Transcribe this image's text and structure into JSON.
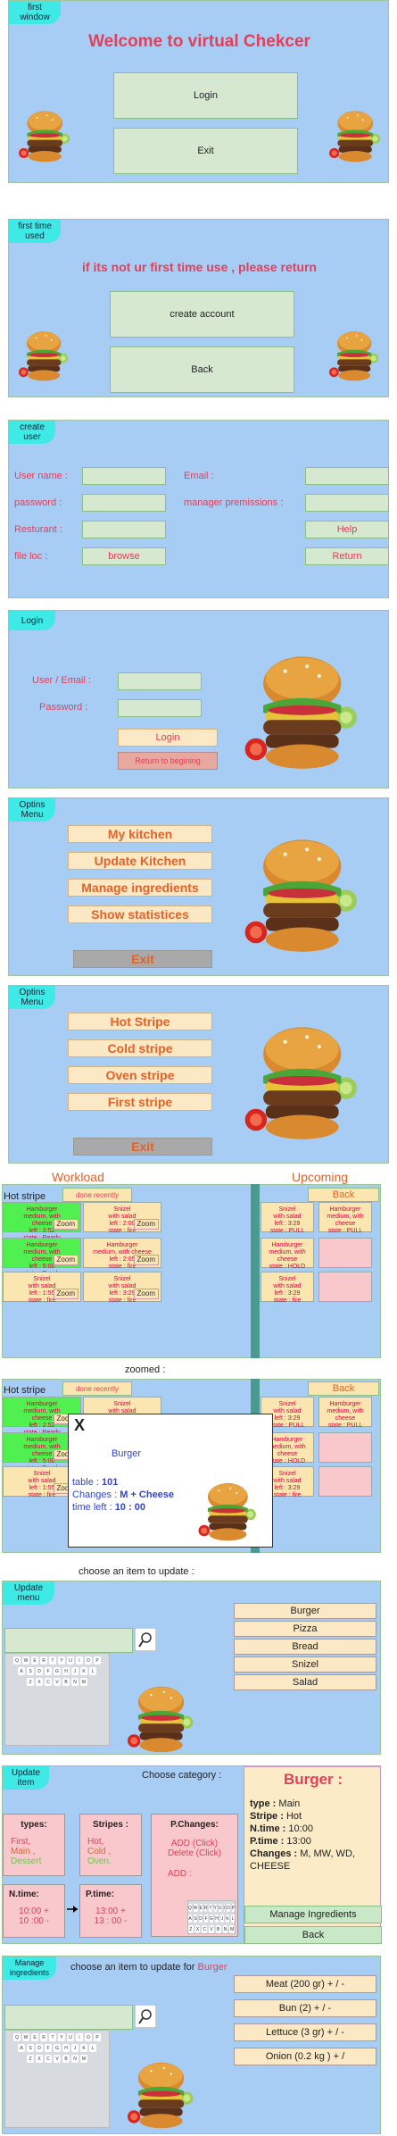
{
  "s1": {
    "tag": "first window",
    "title": "Welcome to virtual Chekcer",
    "login": "Login",
    "exit": "Exit"
  },
  "s2": {
    "tag": "first time used",
    "title": "if its not ur first time use , please return",
    "create": "create account",
    "back": "Back"
  },
  "s3": {
    "tag": "create user",
    "username": "User name :",
    "password": "password :",
    "restaurant": "Resturant :",
    "fileloc": "file loc :",
    "browse": "browse",
    "email": "Email :",
    "manager": "manager premissions :",
    "help": "Help",
    "ret": "Return"
  },
  "s4": {
    "tag": "Login",
    "user": "User / Email :",
    "password": "Password :",
    "login": "Login",
    "back": "Return to begining"
  },
  "s5": {
    "tag": "Optins Menu",
    "items": [
      "My kitchen",
      "Update Kitchen",
      "Manage ingredients",
      "Show statistices"
    ],
    "exit": "Exit"
  },
  "s6": {
    "tag": "Optins Menu",
    "items": [
      "Hot Stripe",
      "Cold stripe",
      "Oven stripe",
      "First stripe"
    ],
    "exit": "Exit"
  },
  "s7": {
    "workload": "Workload",
    "upcoming": "Upcoming",
    "hot": "Hot stripe",
    "done": "done recently",
    "back": "Back",
    "zoom": "Zoom",
    "left": [
      {
        "c": "cg",
        "t": "Hamburger\nmedium, with\ncheese\nleft : 2:52\nstate : Ready"
      },
      {
        "c": "cy",
        "t": "Snizel\nwith salad\nleft : 2:00\nstate : fire"
      },
      {
        "c": "cg",
        "t": "Hamburger\nmedium, with\ncheese\nleft : 5:00\nstate : Ready"
      },
      {
        "c": "cy",
        "t": "Hamburger\nmedium, with cheese\nleft : 2:05\nstate : fire"
      },
      {
        "c": "cy",
        "t": "Snizel\nwith salad\nleft : 1:55\nstate : fire"
      },
      {
        "c": "cy",
        "t": "Snizel\nwith salad\nleft : 3:29\nstate : fire"
      }
    ],
    "right": [
      {
        "c": "cy",
        "t": "Snizel\nwith salad\nleft : 3:29\nstate : PULL"
      },
      {
        "c": "cy",
        "t": "Hamburger\nmedium, with\ncheese\nstate : PULL"
      },
      {
        "c": "cy",
        "t": "Hamburger\nmedium, with\ncheese\nstate : HOLD"
      },
      {
        "c": "cp",
        "t": ""
      },
      {
        "c": "cy",
        "t": "Snizel\nwith salad\nleft : 3:29\nstate : fire"
      },
      {
        "c": "cp",
        "t": ""
      }
    ]
  },
  "s8": {
    "zoomed": "zoomed :",
    "x": "X",
    "item": "Burger",
    "table_l": "table : ",
    "table": "101",
    "changes_l": "Changes : ",
    "changes": "M + Cheese",
    "time_l": "time left : ",
    "time": "10 : 00"
  },
  "s9": {
    "prompt": "choose an item to update :",
    "tag": "Update menu",
    "items": [
      "Burger",
      "Pizza",
      "Bread",
      "Snizel",
      "Salad"
    ]
  },
  "s10": {
    "tag": "Update item",
    "prompt": "Choose category :",
    "title": "Burger :",
    "info": [
      [
        "type : ",
        "Main"
      ],
      [
        "Stripe : ",
        "Hot"
      ],
      [
        "N.time : ",
        "10:00"
      ],
      [
        "P.time : ",
        "13:00"
      ],
      [
        "Changes : ",
        "M, MW, WD, CHEESE"
      ]
    ],
    "types": "types:",
    "typesv": [
      "First,",
      "Main ,",
      "Dessert"
    ],
    "stripes": "Stripes :",
    "stripesv": [
      "Hot,",
      "Cold ,",
      "Oven."
    ],
    "pch": "P.Changes:",
    "add_c": "ADD (Click)",
    "del_c": "Delete (Click)",
    "add": "ADD :",
    "ntime": "N.time:",
    "ntv": [
      "10:00 +",
      "10 :00 -"
    ],
    "ptime": "P.time:",
    "ptv": [
      "13:00 +",
      "13 : 00 -"
    ],
    "manage": "Manage Ingredients",
    "back": "Back"
  },
  "s11": {
    "tag": "Manage ingredients",
    "prompt": "choose an item to update for ",
    "item": "Burger",
    "items": [
      "Meat (200 gr) + / -",
      "Bun (2)  + / -",
      "Lettuce (3 gr)  + / -",
      "Onion (0.2 kg )  + /"
    ]
  },
  "colors": {
    "panel": "#a8cdf5",
    "tag": "#3fe9e6",
    "red": "#e0405a",
    "orange": "#e2632a"
  },
  "icons": [
    "burger-image",
    "search-icon",
    "keyboard"
  ]
}
